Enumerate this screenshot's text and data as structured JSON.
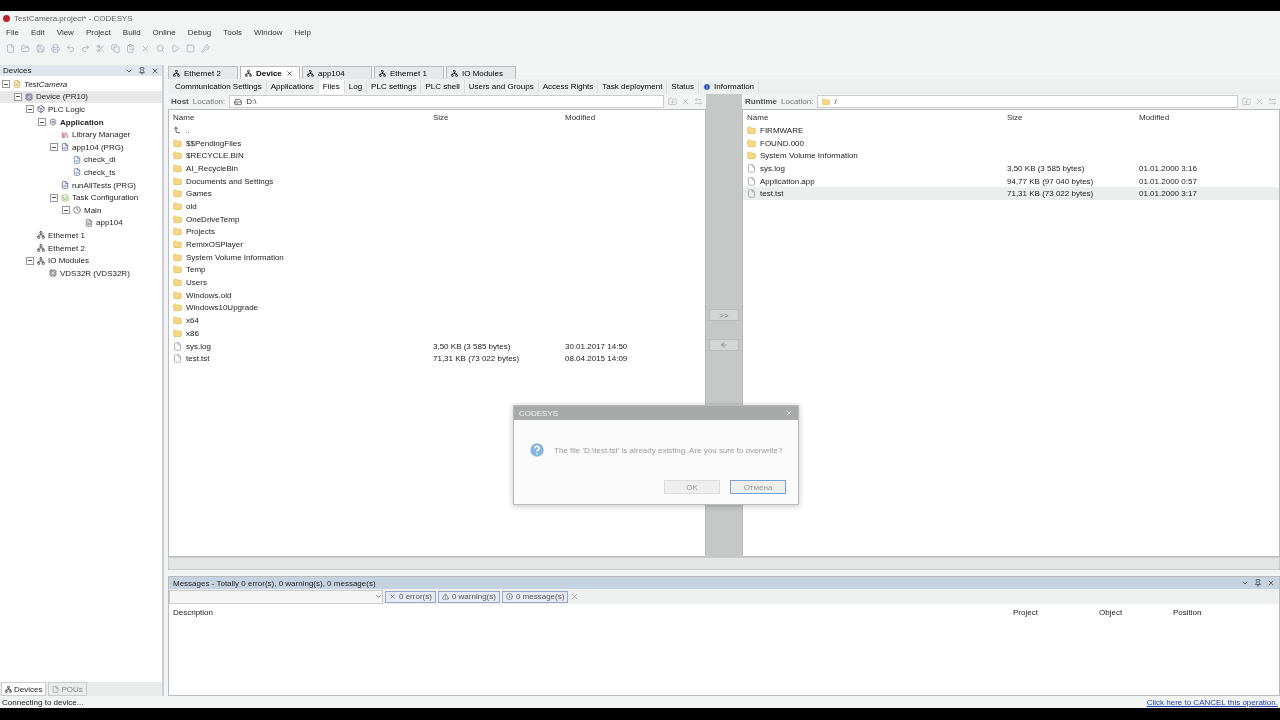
{
  "window": {
    "title": "TestCamera.project* - CODESYS"
  },
  "menu": [
    "File",
    "Edit",
    "View",
    "Project",
    "Build",
    "Online",
    "Debug",
    "Tools",
    "Window",
    "Help"
  ],
  "devices_panel": {
    "title": "Devices",
    "tree": [
      {
        "label": "TestCamera",
        "kind": "project",
        "selected": false,
        "expanded": true,
        "children": [
          {
            "label": "Device (PR10)",
            "kind": "device",
            "selected": true,
            "expanded": true,
            "children": [
              {
                "label": "PLC Logic",
                "kind": "plc",
                "selected": false,
                "expanded": true,
                "children": [
                  {
                    "label": "Application",
                    "kind": "app",
                    "selected": false,
                    "expanded": true,
                    "children": [
                      {
                        "label": "Library Manager",
                        "kind": "library",
                        "selected": false
                      },
                      {
                        "label": "app104 (PRG)",
                        "kind": "pou",
                        "selected": false,
                        "expanded": true,
                        "children": [
                          {
                            "label": "check_di",
                            "kind": "action",
                            "selected": false
                          },
                          {
                            "label": "check_ts",
                            "kind": "action",
                            "selected": false
                          }
                        ]
                      },
                      {
                        "label": "runAllTests (PRG)",
                        "kind": "pou",
                        "selected": false
                      },
                      {
                        "label": "Task Configuration",
                        "kind": "taskconfig",
                        "selected": false,
                        "expanded": true,
                        "children": [
                          {
                            "label": "Main",
                            "kind": "task",
                            "selected": false,
                            "expanded": true,
                            "children": [
                              {
                                "label": "app104",
                                "kind": "call",
                                "selected": false
                              }
                            ]
                          }
                        ]
                      }
                    ]
                  }
                ]
              },
              {
                "label": "Ethernet 1",
                "kind": "net",
                "selected": false
              },
              {
                "label": "Ethernet 2",
                "kind": "net",
                "selected": false
              },
              {
                "label": "IO Modules",
                "kind": "net",
                "selected": false,
                "expanded": true,
                "children": [
                  {
                    "label": "VDS32R (VDS32R)",
                    "kind": "device",
                    "selected": false
                  }
                ]
              }
            ]
          }
        ]
      }
    ],
    "bottom_tabs": [
      {
        "label": "Devices",
        "selected": true
      },
      {
        "label": "POUs",
        "selected": false
      }
    ]
  },
  "editor_tabs": [
    {
      "label": "Ethernet 2",
      "selected": false
    },
    {
      "label": "Device",
      "selected": true
    },
    {
      "label": "app104",
      "selected": false
    },
    {
      "label": "Ethernet 1",
      "selected": false
    },
    {
      "label": "IO Modules",
      "selected": false
    }
  ],
  "sub_tabs": [
    {
      "label": "Communication Settings",
      "selected": false
    },
    {
      "label": "Applications",
      "selected": false
    },
    {
      "label": "Files",
      "selected": true
    },
    {
      "label": "Log",
      "selected": false
    },
    {
      "label": "PLC settings",
      "selected": false
    },
    {
      "label": "PLC shell",
      "selected": false
    },
    {
      "label": "Users and Groups",
      "selected": false
    },
    {
      "label": "Access Rights",
      "selected": false
    },
    {
      "label": "Task deployment",
      "selected": false
    },
    {
      "label": "Status",
      "selected": false
    },
    {
      "label": "Information",
      "selected": false
    }
  ],
  "host": {
    "label": "Host",
    "location_label": "Location:",
    "path": "D:\\",
    "columns": [
      "Name",
      "Size",
      "Modified"
    ],
    "rows": [
      {
        "kind": "up",
        "name": "..",
        "selected": false
      },
      {
        "kind": "folder",
        "name": "$$PendingFiles",
        "selected": false
      },
      {
        "kind": "folder",
        "name": "$RECYCLE.BIN",
        "selected": false
      },
      {
        "kind": "folder",
        "name": "AI_RecycleBin",
        "selected": false
      },
      {
        "kind": "folder",
        "name": "Documents and Settings",
        "selected": false
      },
      {
        "kind": "folder",
        "name": "Games",
        "selected": false
      },
      {
        "kind": "folder",
        "name": "old",
        "selected": false
      },
      {
        "kind": "folder",
        "name": "OneDriveTemp",
        "selected": false
      },
      {
        "kind": "folder",
        "name": "Projects",
        "selected": false
      },
      {
        "kind": "folder",
        "name": "RemixOSPlayer",
        "selected": false
      },
      {
        "kind": "folder",
        "name": "System Volume Information",
        "selected": false
      },
      {
        "kind": "folder",
        "name": "Temp",
        "selected": false
      },
      {
        "kind": "folder",
        "name": "Users",
        "selected": false
      },
      {
        "kind": "folder",
        "name": "Windows.old",
        "selected": false
      },
      {
        "kind": "folder",
        "name": "Windows10Upgrade",
        "selected": false
      },
      {
        "kind": "folder",
        "name": "x64",
        "selected": false
      },
      {
        "kind": "folder",
        "name": "x86",
        "selected": false
      },
      {
        "kind": "file",
        "name": "sys.log",
        "size": "3,50 KB (3 585 bytes)",
        "modified": "30.01.2017 14:50",
        "selected": false
      },
      {
        "kind": "file",
        "name": "test.tst",
        "size": "71,31 KB (73 022 bytes)",
        "modified": "08.04.2015 14:09",
        "selected": false
      }
    ]
  },
  "transfer_buttons": [
    {
      "label": ">>"
    }
  ],
  "runtime": {
    "label": "Runtime",
    "location_label": "Location:",
    "path": "/",
    "columns": [
      "Name",
      "Size",
      "Modified"
    ],
    "rows": [
      {
        "kind": "folder",
        "name": "FIRMWARE",
        "selected": false
      },
      {
        "kind": "folder",
        "name": "FOUND.000",
        "selected": false
      },
      {
        "kind": "folder",
        "name": "System Volume Information",
        "selected": false
      },
      {
        "kind": "file",
        "name": "sys.log",
        "size": "3,50 KB (3 585 bytes)",
        "modified": "01.01.2000 3:16",
        "selected": false
      },
      {
        "kind": "file",
        "name": "Application.app",
        "size": "94,77 KB (97 040 bytes)",
        "modified": "01.01.2000 0:57",
        "selected": false
      },
      {
        "kind": "file",
        "name": "test.tst",
        "size": "71,31 KB (73 022 bytes)",
        "modified": "01.01.2000 3:17",
        "selected": true
      }
    ]
  },
  "dialog": {
    "title": "CODESYS",
    "message": "The file 'D:\\test.tst' is already existing. Are you sure to overwrite?",
    "buttons": [
      {
        "label": "OK",
        "default": false
      },
      {
        "label": "Отмена",
        "default": true
      }
    ]
  },
  "messages": {
    "title": "Messages - Totally 0 error(s), 0 warning(s), 0 message(s)",
    "filters": [
      {
        "kind": "error",
        "label": "0 error(s)"
      },
      {
        "kind": "warning",
        "label": "0 warning(s)"
      },
      {
        "kind": "info",
        "label": "0 message(s)"
      }
    ],
    "columns": [
      "Description",
      "Project",
      "Object",
      "Position"
    ]
  },
  "status_bar": {
    "text": "Connecting to device...",
    "cancel_link": "Click here to CANCEL this operation."
  }
}
